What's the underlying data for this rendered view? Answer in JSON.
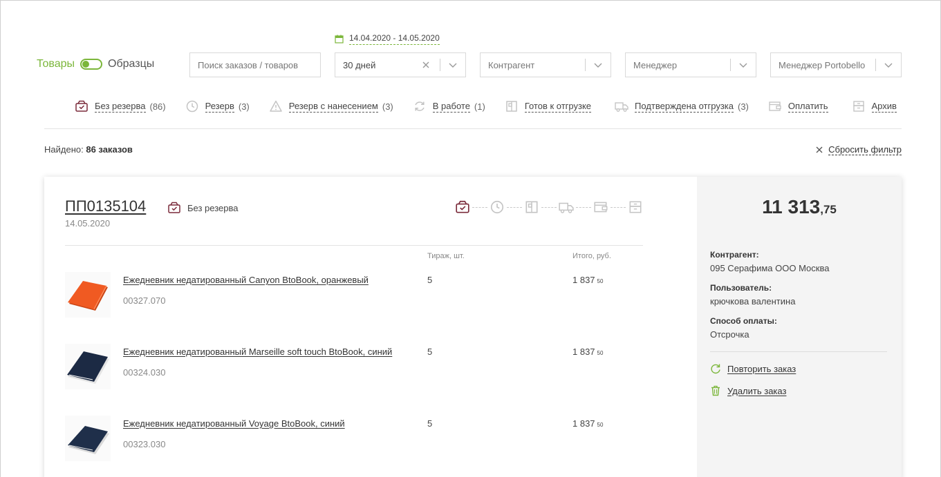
{
  "filters": {
    "toggle_left": "Товары",
    "toggle_right": "Образцы",
    "date_range": "14.04.2020 - 14.05.2020",
    "search_placeholder": "Поиск заказов / товаров",
    "period_value": "30 дней",
    "counterparty_placeholder": "Контрагент",
    "manager_placeholder": "Менеджер",
    "portobello_manager_placeholder": "Менеджер Portobello"
  },
  "tabs": [
    {
      "label": "Без резерва",
      "count": "(86)",
      "icon": "box-check-icon"
    },
    {
      "label": "Резерв",
      "count": "(3)",
      "icon": "clock-icon"
    },
    {
      "label": "Резерв с нанесением",
      "count": "(3)",
      "icon": "warning-icon"
    },
    {
      "label": "В работе",
      "count": "(1)",
      "icon": "refresh-icon"
    },
    {
      "label": "Готов к отгрузке",
      "count": "",
      "icon": "package-icon"
    },
    {
      "label": "Подтверждена отгрузка",
      "count": "(3)",
      "icon": "truck-icon"
    },
    {
      "label": "Оплатить",
      "count": "",
      "icon": "wallet-icon"
    },
    {
      "label": "Архив",
      "count": "",
      "icon": "archive-icon"
    }
  ],
  "results": {
    "found_label": "Найдено:",
    "found_value": "86 заказов",
    "reset_label": "Сбросить фильтр"
  },
  "order": {
    "number": "ПП0135104",
    "date": "14.05.2020",
    "status": "Без резерва",
    "col_qty": "Тираж, шт.",
    "col_total": "Итого, руб.",
    "items": [
      {
        "name": "Ежедневник недатированный Canyon BtoBook, оранжевый",
        "code": "00327.070",
        "qty": "5",
        "price": "1 837",
        "price_dec": "50",
        "color": "#f05a22"
      },
      {
        "name": "Ежедневник недатированный Marseille soft touch BtoBook, синий",
        "code": "00324.030",
        "qty": "5",
        "price": "1 837",
        "price_dec": "50",
        "color": "#1c2a44"
      },
      {
        "name": "Ежедневник недатированный Voyage BtoBook, синий",
        "code": "00323.030",
        "qty": "5",
        "price": "1 837",
        "price_dec": "50",
        "color": "#1f2f4a"
      }
    ],
    "total_int": "11 313",
    "total_dec": ",75",
    "counterparty_label": "Контрагент:",
    "counterparty_value": "095 Серафима ООО Москва",
    "user_label": "Пользователь:",
    "user_value": "крючкова валентина",
    "payment_label": "Способ оплаты:",
    "payment_value": "Отсрочка",
    "repeat_label": "Повторить заказ",
    "delete_label": "Удалить заказ"
  },
  "colors": {
    "accent_green": "#7bb63a",
    "status_maroon": "#7a2a3a",
    "icon_gray": "#c4c4c4"
  }
}
